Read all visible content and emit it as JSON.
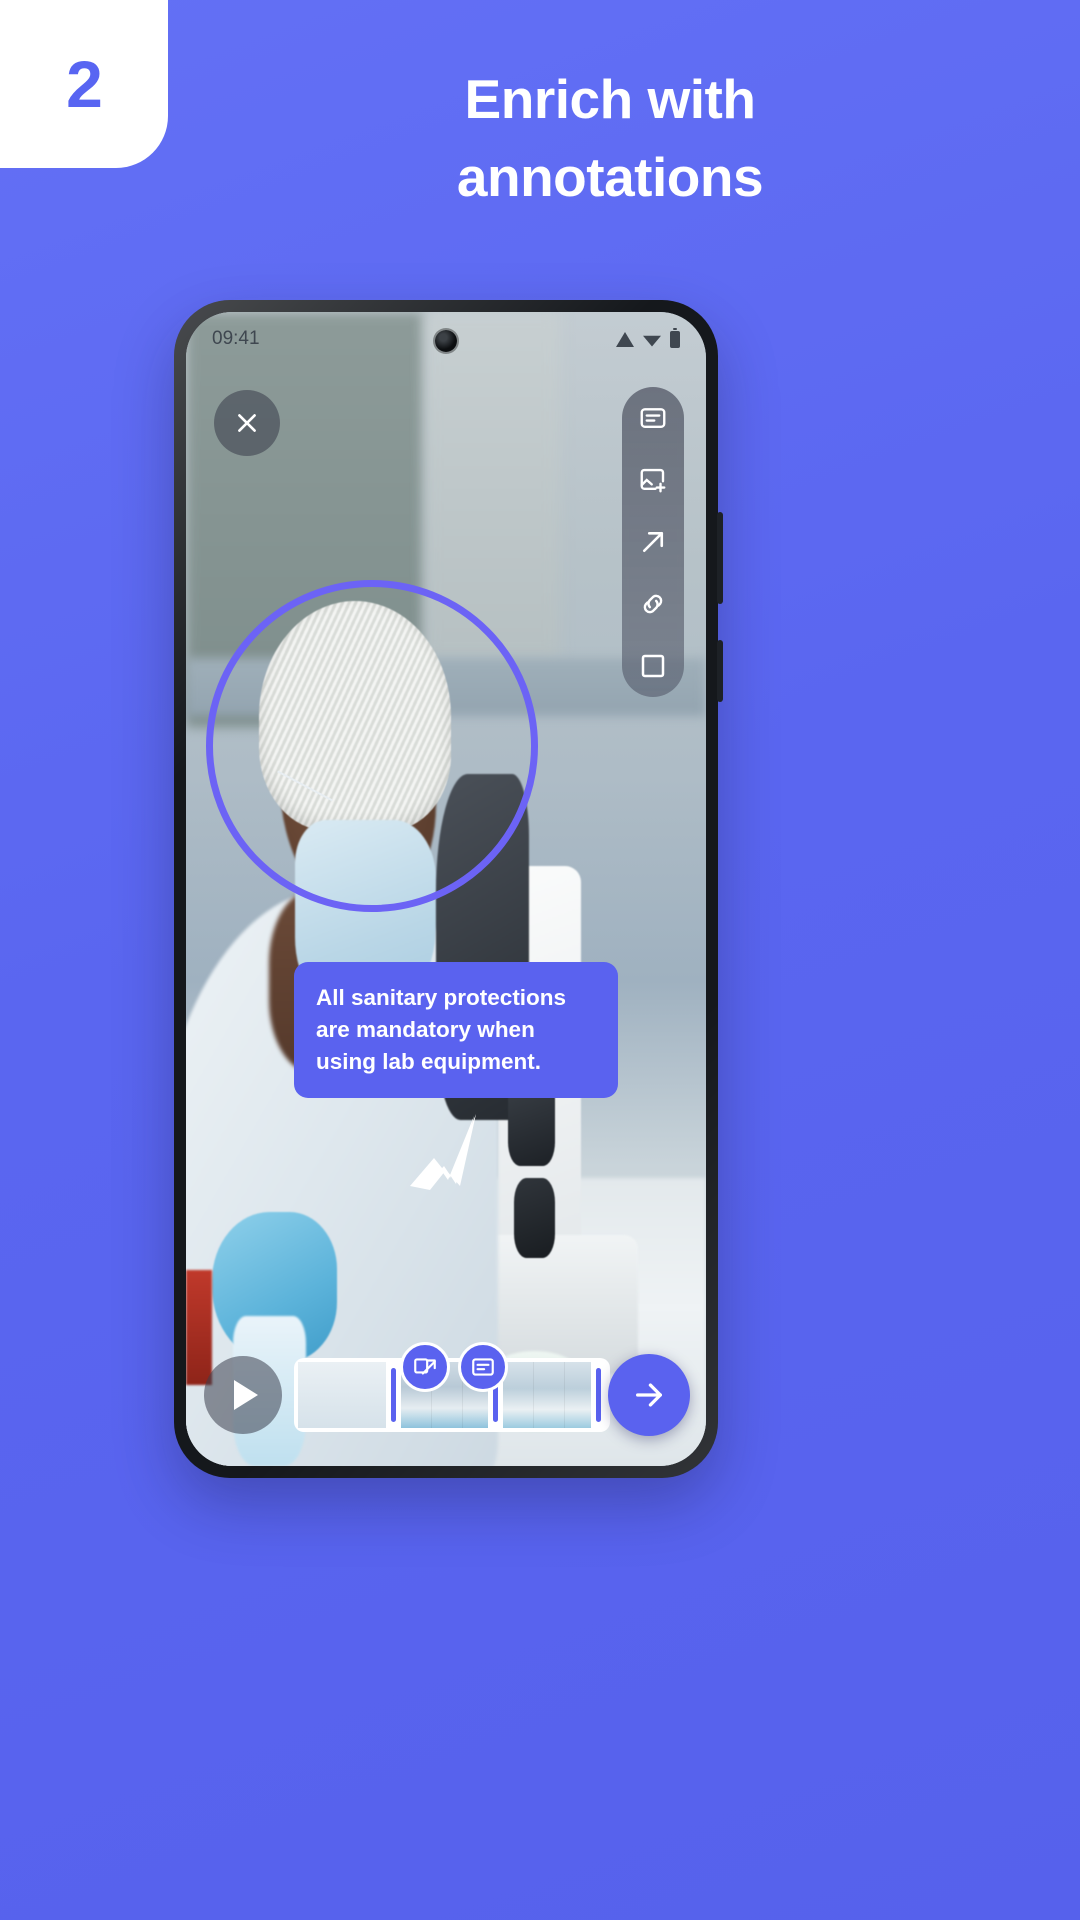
{
  "promo": {
    "step_number": "2",
    "headline_line1": "Enrich with",
    "headline_line2": "annotations",
    "bg_color": "#5865f2",
    "accent_color": "#5a62ef",
    "badge_bg": "#ffffff"
  },
  "phone": {
    "status_bar": {
      "time": "09:41",
      "icons": [
        "signal-icon",
        "wifi-icon",
        "battery-icon"
      ]
    },
    "close_button": {
      "icon": "close-icon"
    },
    "tool_rail": {
      "items": [
        {
          "icon": "text-annotation-icon",
          "label": "Text annotation"
        },
        {
          "icon": "add-image-icon",
          "label": "Add image"
        },
        {
          "icon": "arrow-annotation-icon",
          "label": "Arrow"
        },
        {
          "icon": "link-icon",
          "label": "Link"
        },
        {
          "icon": "shape-rectangle-icon",
          "label": "Rectangle"
        }
      ]
    },
    "highlight_circle": {
      "shape": "circle",
      "color": "#6c63f5"
    },
    "callout": {
      "text": "All sanitary protections are mandatory when using lab equipment.",
      "bg": "#5a62ef",
      "text_color": "#ffffff"
    },
    "arrow_annotation": {
      "icon": "arrow-down-left-icon",
      "color": "#ffffff"
    },
    "bottom_bar": {
      "play_button": {
        "icon": "play-icon"
      },
      "next_button": {
        "icon": "arrow-right-icon",
        "bg": "#5a62ef"
      },
      "timeline": {
        "clips": [
          "clip-1",
          "clip-2",
          "clip-3"
        ],
        "markers": 3,
        "badges": [
          {
            "icon": "crop-move-icon"
          },
          {
            "icon": "text-caption-icon"
          }
        ]
      }
    }
  }
}
